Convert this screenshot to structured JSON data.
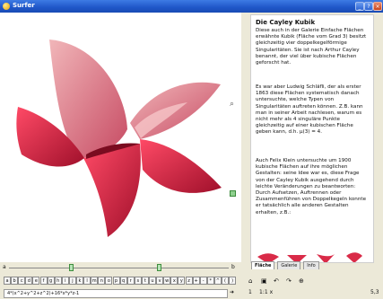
{
  "window": {
    "title": "Surfer",
    "buttons": {
      "minimize": "_",
      "help": "?",
      "close": "×"
    }
  },
  "text_panel": {
    "title": "Die Cayley Kubik",
    "paragraphs": [
      "Diese auch in der Galerie Einfache Flächen erwähnte Kubik (Fläche vom Grad 3) besitzt gleichzeitig vier doppelkegelförmige Singularitäten. Sie ist nach Arthur Cayley benannt, der viel über kubische Flächen geforscht hat.",
      "Es war aber Ludwig Schläfli, der als erster 1863 diese Flächen systematisch danach untersuchte, welche Typen von Singularitäten auftreten können. Z.B. kann man in seiner Arbeit nachlesen, warum es nicht mehr als 4 singuläre Punkte gleichzeitig auf einer kubischen Fläche geben kann, d.h. µ(3) = 4.",
      "Auch Felix Klein untersuchte um 1900 kubische Flächen auf ihre möglichen Gestalten: seine Idee war es, diese Frage von der Cayley Kubik ausgehend durch leichte Veränderungen zu beantworten: Durch Aufsetzen, Auftrennen oder Zusammenführen von Doppelkegeln konnte er tatsächlich alle anderen Gestalten erhalten, z.B.:"
    ],
    "tabs": [
      "Fläche",
      "Galerie",
      "Info"
    ],
    "active_tab": "Fläche"
  },
  "sliders": {
    "left_label": "a",
    "right_label": "b",
    "positions": [
      0.28,
      0.68
    ]
  },
  "keyboard": {
    "keys": [
      "a",
      "b",
      "c",
      "d",
      "e",
      "f",
      "g",
      "h",
      "i",
      "j",
      "k",
      "l",
      "m",
      "n",
      "o",
      "p",
      "q",
      "r",
      "s",
      "t",
      "u",
      "v",
      "w",
      "x",
      "y",
      "z",
      "+",
      "-",
      "*",
      "^",
      "(",
      ")"
    ]
  },
  "input": {
    "formula": "4*(x^2+y^2+z^2)+16*x*y*z-1",
    "go_icon": "arrow-right-icon"
  },
  "controls": {
    "icons": [
      "home-icon",
      "save-icon",
      "undo-icon",
      "redo-icon",
      "zoom-icon"
    ]
  },
  "status": {
    "left": "1",
    "mid": "1:1 x",
    "right": "5,3"
  },
  "colors": {
    "surface_front": "#d92b48",
    "surface_back": "#e79aa0",
    "titlebar": "#2a5fd0"
  }
}
